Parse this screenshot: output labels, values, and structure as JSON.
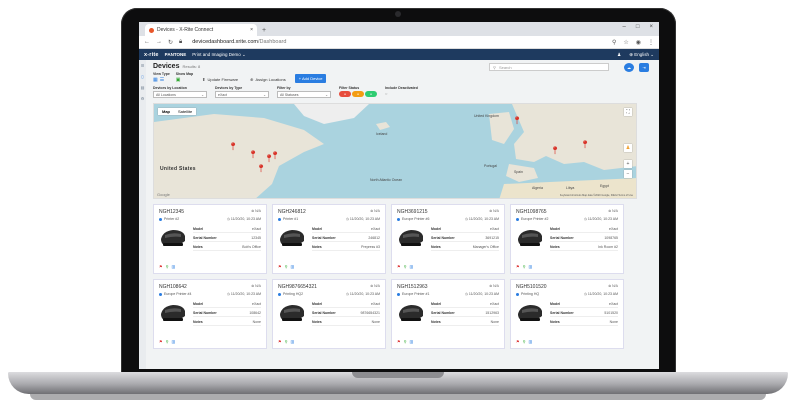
{
  "browser": {
    "tab_title": "Devices - X-Rite Connect",
    "tab_close": "×",
    "new_tab": "+",
    "url_host": "devicedashboard.xrite.com",
    "url_path": "/Dashboard",
    "window_controls": [
      "–",
      "□",
      "×"
    ]
  },
  "app": {
    "brand": "x-rite",
    "pantone": "PANTONE",
    "menu": "Print and Imaging Demo ⌄",
    "language": "⊕ English ⌄",
    "user": "♟"
  },
  "page": {
    "title": "Devices",
    "results": "Results: 8",
    "search_placeholder": "Search"
  },
  "toolbar": {
    "view_type_label": "View Type",
    "show_map_label": "Show Map",
    "update_firmware": "Update Firmware",
    "assign_locations": "Assign Locations",
    "add_device": "+ Add Device"
  },
  "filters": {
    "location_label": "Devices by Location",
    "location_value": "All Locations",
    "type_label": "Devices by Type",
    "type_value": "eXact",
    "filter_by_label": "Filter by",
    "filter_by_value": "All Statuses",
    "status_label": "Filter Status",
    "include_label": "Include Deactivated"
  },
  "map": {
    "tab_map": "Map",
    "tab_satellite": "Satellite",
    "label_us": "United States",
    "label_google": "Google",
    "footer": "Keyboard shortcuts  Map data ©2020 Google, INEGI  Terms of Use",
    "labels": [
      "Iceland",
      "United Kingdom",
      "Portugal",
      "Spain",
      "Algeria",
      "Libya",
      "Egypt",
      "North Atlantic Ocean"
    ]
  },
  "cards": [
    {
      "name": "NGH12345",
      "na": "⊗ N/A",
      "printer": "Printer #2",
      "time": "◷ 11/20/20, 10:23 AM",
      "model": "eXact",
      "serial": "12345",
      "notes": "Bob's Office"
    },
    {
      "name": "NGH246812",
      "na": "⊗ N/A",
      "printer": "Printer #1",
      "time": "◷ 11/20/20, 10:23 AM",
      "model": "eXact",
      "serial": "246812",
      "notes": "Prepress #3"
    },
    {
      "name": "NGH3691215",
      "na": "⊗ N/A",
      "printer": "Europe Printer #6",
      "time": "◷ 11/20/20, 10:23 AM",
      "model": "eXact",
      "serial": "3691215",
      "notes": "Manager's Office"
    },
    {
      "name": "NGH1098765",
      "na": "⊗ N/A",
      "printer": "Europe Printer #2",
      "time": "◷ 11/20/20, 10:23 AM",
      "model": "eXact",
      "serial": "1098765",
      "notes": "Ink Room #2"
    },
    {
      "name": "NGH108642",
      "na": "⊗ N/A",
      "printer": "Europe Printer #4",
      "time": "◷ 11/20/20, 10:23 AM",
      "model": "eXact",
      "serial": "108642",
      "notes": "None"
    },
    {
      "name": "NGH9876654321",
      "na": "⊗ N/A",
      "printer": "Printing HQ2",
      "time": "◷ 11/20/20, 10:23 AM",
      "model": "eXact",
      "serial": "9876654321",
      "notes": "None"
    },
    {
      "name": "NGH1512963",
      "na": "⊗ N/A",
      "printer": "Europe Printer #1",
      "time": "◷ 11/20/20, 10:23 AM",
      "model": "eXact",
      "serial": "1512963",
      "notes": "None"
    },
    {
      "name": "NGH5101520",
      "na": "⊗ N/A",
      "printer": "Printing HQ",
      "time": "◷ 11/20/20, 10:23 AM",
      "model": "eXact",
      "serial": "5101520",
      "notes": "None"
    }
  ],
  "card_labels": {
    "model": "Model",
    "serial": "Serial Number",
    "notes": "Notes"
  },
  "colors": {
    "accent": "#2a7de1",
    "header": "#1e3a5f",
    "pin": "#d9352b"
  }
}
